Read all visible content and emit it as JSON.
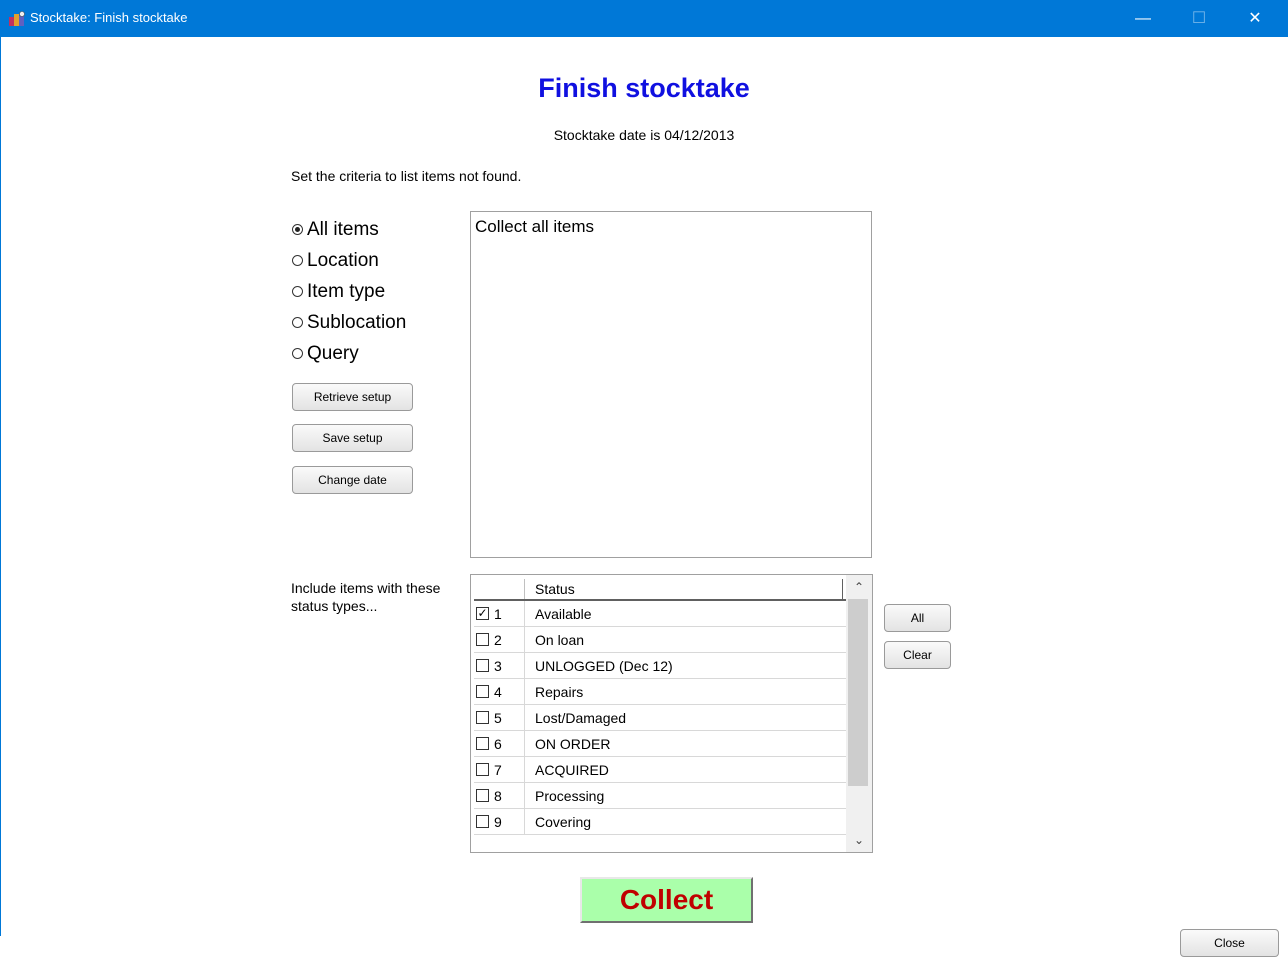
{
  "window": {
    "title": "Stocktake: Finish stocktake",
    "minimize_glyph": "—",
    "maximize_glyph": "☐",
    "close_glyph": "✕"
  },
  "heading": "Finish stocktake",
  "date_line": "Stocktake date is 04/12/2013",
  "instructions": "Set the criteria to list items not found.",
  "criteria": {
    "options": [
      "All items",
      "Location",
      "Item type",
      "Sublocation",
      "Query"
    ],
    "selected": "All items",
    "description": "Collect all items"
  },
  "buttons": {
    "retrieve_setup": "Retrieve setup",
    "save_setup": "Save setup",
    "change_date": "Change date",
    "all": "All",
    "clear": "Clear",
    "collect": "Collect",
    "close": "Close"
  },
  "include_label": "Include items with these status types...",
  "status_grid": {
    "header": "Status",
    "rows": [
      {
        "num": "1",
        "label": "Available",
        "checked": true
      },
      {
        "num": "2",
        "label": "On loan",
        "checked": false
      },
      {
        "num": "3",
        "label": "UNLOGGED (Dec 12)",
        "checked": false
      },
      {
        "num": "4",
        "label": "Repairs",
        "checked": false
      },
      {
        "num": "5",
        "label": "Lost/Damaged",
        "checked": false
      },
      {
        "num": "6",
        "label": "ON ORDER",
        "checked": false
      },
      {
        "num": "7",
        "label": "ACQUIRED",
        "checked": false
      },
      {
        "num": "8",
        "label": "Processing",
        "checked": false
      },
      {
        "num": "9",
        "label": "Covering",
        "checked": false
      }
    ]
  },
  "colors": {
    "titlebar": "#0078d7",
    "heading": "#1010e0",
    "collect_bg": "#aaffaa",
    "collect_text": "#c00000"
  }
}
